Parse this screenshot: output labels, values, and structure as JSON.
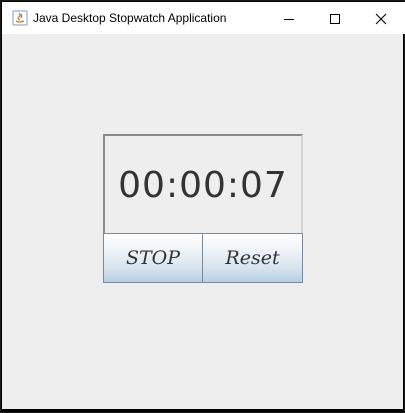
{
  "window": {
    "title": "Java Desktop Stopwatch Application"
  },
  "stopwatch": {
    "time": "00:00:07",
    "stop_label": "STOP",
    "reset_label": "Reset"
  },
  "icons": {
    "app": "java-icon",
    "minimize": "minimize-icon",
    "maximize": "maximize-icon",
    "close": "close-icon"
  },
  "colors": {
    "background": "#eeeeee",
    "titlebar": "#ffffff",
    "button_gradient_top": "#ffffff",
    "button_gradient_bottom": "#b8cfe5",
    "text": "#333333"
  }
}
